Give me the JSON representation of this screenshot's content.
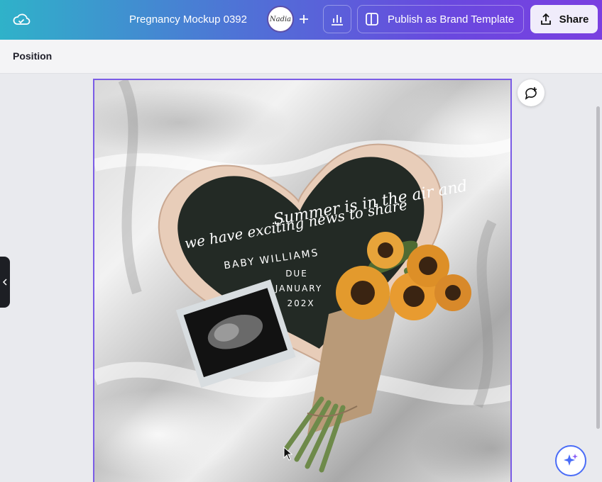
{
  "topbar": {
    "cloud_icon": "cloud-check-icon",
    "document_title": "Pregnancy Mockup 0392",
    "avatar_text": "Nadia",
    "add_icon": "plus-icon",
    "analytics_icon": "bar-chart-icon",
    "publish_label": "Publish as Brand Template",
    "publish_icon": "template-panel-icon",
    "share_label": "Share",
    "share_icon": "upload-share-icon"
  },
  "toolbar": {
    "position_label": "Position"
  },
  "canvas": {
    "letterboard": {
      "script_line_1": "Summer is in the air and",
      "script_line_2": "we have exciting news to share",
      "name_line": "BABY WILLIAMS",
      "due_line": "DUE",
      "month_line": "JANUARY",
      "year_line": "202X"
    }
  },
  "side_panel": {
    "collapse_icon": "chevron-left-icon"
  },
  "floating": {
    "comment_icon": "add-comment-icon",
    "magic_icon": "sparkle-icon"
  },
  "colors": {
    "accent": "#7b5ce6",
    "letterboard": "#232a25",
    "frame": "#e8cdb9"
  }
}
